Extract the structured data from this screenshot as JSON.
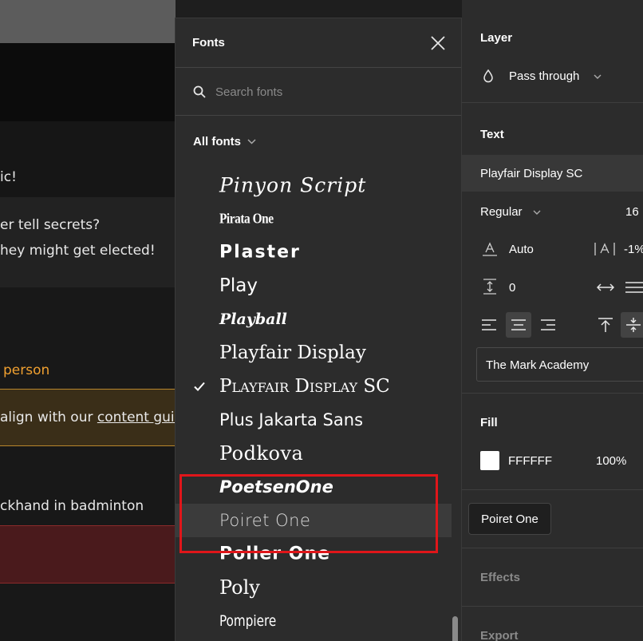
{
  "canvas": {
    "lines": [
      "ic!",
      "er tell secrets?",
      "hey might get elected!",
      "person",
      "align with our ",
      "content guidel",
      "ckhand in badminton"
    ]
  },
  "fonts_panel": {
    "title": "Fonts",
    "search_placeholder": "Search fonts",
    "filter_label": "All fonts",
    "fonts": [
      "Pinyon Script",
      "Pirata One",
      "Plaster",
      "Play",
      "Playball",
      "Playfair Display",
      "Playfair Display SC",
      "Plus Jakarta Sans",
      "Podkova",
      "PoetsenOne",
      "Poiret One",
      "Poller One",
      "Poly",
      "Pompiere"
    ],
    "selected_font": "Playfair Display SC",
    "hovered_font": "Poiret One"
  },
  "tooltip": {
    "text": "Poiret One"
  },
  "right_panel": {
    "layer": {
      "title": "Layer",
      "blend_mode": "Pass through"
    },
    "text": {
      "title": "Text",
      "font_family": "Playfair Display SC",
      "font_weight": "Regular",
      "font_size": "16",
      "line_height": "Auto",
      "letter_spacing": "-1%",
      "paragraph_spacing": "0",
      "text_style": "The Mark Academy"
    },
    "fill": {
      "title": "Fill",
      "hex": "FFFFFF",
      "opacity": "100%",
      "color": "#ffffff"
    },
    "effects": {
      "title": "Effects"
    },
    "export": {
      "title": "Export"
    }
  },
  "colors": {
    "accent_orange": "#f0a030",
    "highlight_red": "#e0161a",
    "warning_bg": "#3a2e18",
    "error_bg": "#4a1a1c"
  }
}
